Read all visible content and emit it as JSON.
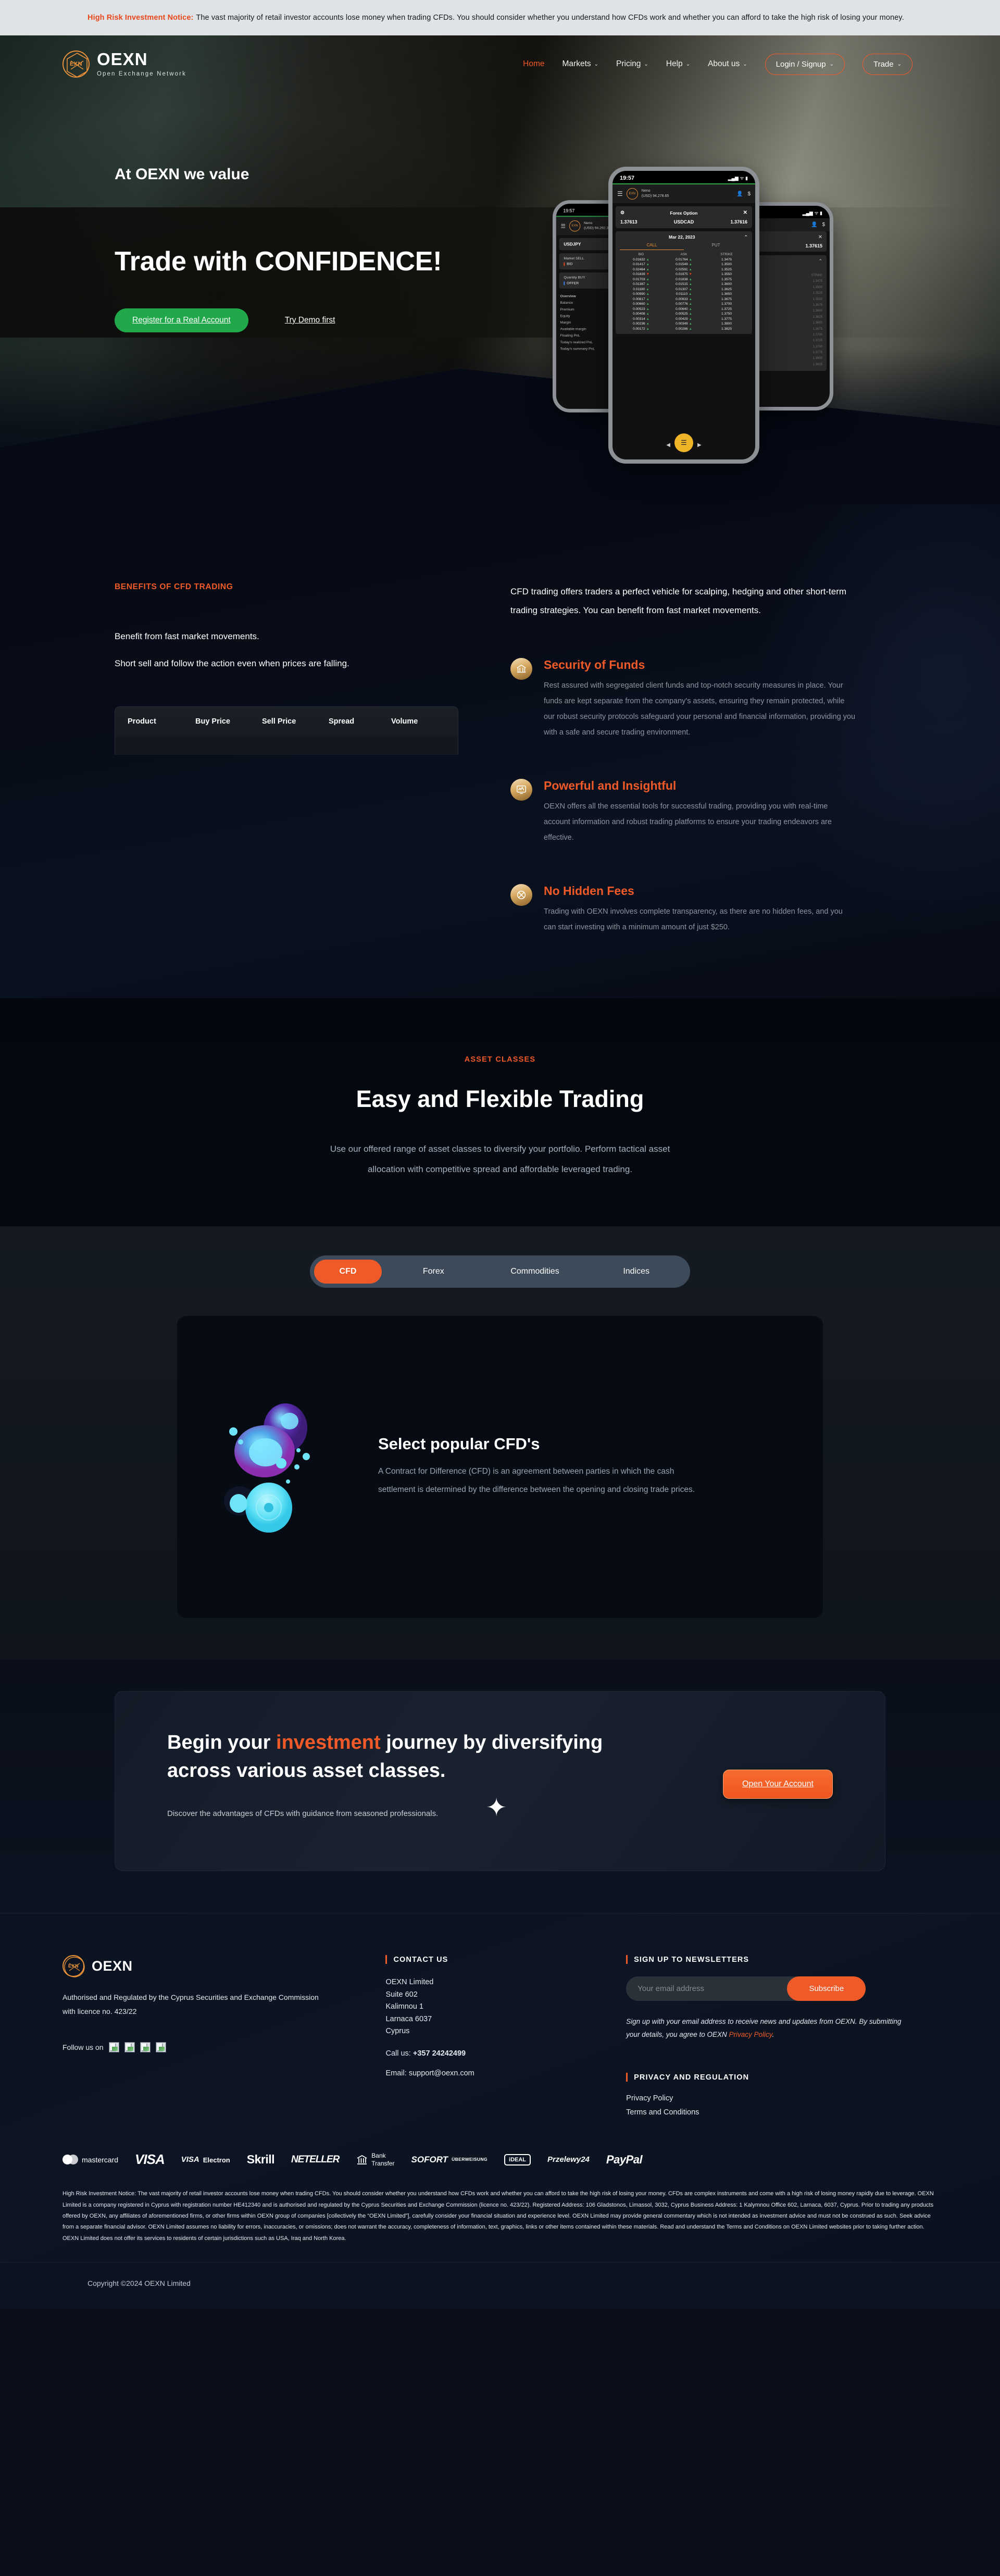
{
  "risk_banner": {
    "bold": "High Risk Investment Notice:",
    "text": " The vast majority of retail investor accounts lose money when trading CFDs. You should consider whether you understand how CFDs work and whether you can afford to take the high risk of losing your money."
  },
  "brand": {
    "name": "OEXN",
    "tagline": "Open Exchange Network",
    "mark": "EXN"
  },
  "nav": {
    "links": [
      {
        "label": "Home",
        "caret": "",
        "active": true
      },
      {
        "label": "Markets",
        "caret": "⌄",
        "active": false
      },
      {
        "label": "Pricing",
        "caret": "⌄",
        "active": false
      },
      {
        "label": "Help",
        "caret": "⌄",
        "active": false
      },
      {
        "label": "About us",
        "caret": "⌄",
        "active": false
      }
    ],
    "login_button": "Login / Signup",
    "login_caret": "⌄",
    "trade_button": "Trade",
    "trade_caret": "⌄"
  },
  "hero": {
    "kicker": "At OEXN we value",
    "title": "Trade with CONFIDENCE!",
    "cta_primary": "Register for a Real Account",
    "cta_secondary": "Try Demo first"
  },
  "phone": {
    "time": "19:57",
    "account_name": "Neno",
    "account_balance": "(USD) 94,278.65",
    "left_time": "19:57",
    "left_account_balance": "(USD) 94,292.39",
    "left_pair": "USDJPY",
    "left_market_sell": "Market SELL",
    "left_bid": "BID",
    "left_quantity_buy": "Quantity BUY",
    "left_offer": "OFFER",
    "left_overview": "Overview",
    "left_rows": [
      "Balance",
      "Premium",
      "Equity",
      "Margin",
      "Available margin",
      "Floating PnL",
      "Today's realized PnL",
      "Today's summary PnL"
    ],
    "card_title": "Forex Option",
    "bid_quote": "1.37613",
    "pair": "USDCAD",
    "ask_quote": "1.37616",
    "right_quote": "1.37615",
    "date": "Mar 22, 2023",
    "tab_call": "CALL",
    "tab_put": "PUT",
    "columns": [
      "BID",
      "ASK",
      "STRIKE"
    ],
    "rows": [
      {
        "bid": "0.01632",
        "bid_dir": "up",
        "ask": "0.01764",
        "ask_dir": "up",
        "strike": "1.3475"
      },
      {
        "bid": "0.01417",
        "bid_dir": "up",
        "ask": "0.01549",
        "ask_dir": "up",
        "strike": "1.3500"
      },
      {
        "bid": "0.02464",
        "bid_dir": "up",
        "ask": "0.02591",
        "ask_dir": "up",
        "strike": "1.3525"
      },
      {
        "bid": "0.01839",
        "bid_dir": "down",
        "ask": "0.01975",
        "ask_dir": "down",
        "strike": "1.3550"
      },
      {
        "bid": "0.01703",
        "bid_dir": "up",
        "ask": "0.01838",
        "ask_dir": "up",
        "strike": "1.3575"
      },
      {
        "bid": "0.01387",
        "bid_dir": "up",
        "ask": "0.01515",
        "ask_dir": "up",
        "strike": "1.3600"
      },
      {
        "bid": "0.01180",
        "bid_dir": "up",
        "ask": "0.01307",
        "ask_dir": "up",
        "strike": "1.3625"
      },
      {
        "bid": "0.00990",
        "bid_dir": "up",
        "ask": "0.01110",
        "ask_dir": "up",
        "strike": "1.3650"
      },
      {
        "bid": "0.00817",
        "bid_dir": "up",
        "ask": "0.00933",
        "ask_dir": "up",
        "strike": "1.3675"
      },
      {
        "bid": "0.00660",
        "bid_dir": "up",
        "ask": "0.00776",
        "ask_dir": "up",
        "strike": "1.3700"
      },
      {
        "bid": "0.00523",
        "bid_dir": "up",
        "ask": "0.00640",
        "ask_dir": "up",
        "strike": "1.3725"
      },
      {
        "bid": "0.00408",
        "bid_dir": "up",
        "ask": "0.00525",
        "ask_dir": "up",
        "strike": "1.3750"
      },
      {
        "bid": "0.00314",
        "bid_dir": "up",
        "ask": "0.00429",
        "ask_dir": "up",
        "strike": "1.3775"
      },
      {
        "bid": "0.00236",
        "bid_dir": "up",
        "ask": "0.00349",
        "ask_dir": "up",
        "strike": "1.3800"
      },
      {
        "bid": "0.00172",
        "bid_dir": "up",
        "ask": "0.00286",
        "ask_dir": "up",
        "strike": "1.3825"
      }
    ]
  },
  "benefits": {
    "kicker": "BENEFITS OF CFD TRADING",
    "line1": "Benefit from fast market movements.",
    "line2": "Short sell and follow the action even when prices are falling.",
    "intro": "CFD trading offers traders a perfect vehicle for scalping, hedging and other short-term trading strategies. You can benefit from fast market movements.",
    "table_headers": [
      "Product",
      "Buy Price",
      "Sell Price",
      "Spread",
      "Volume"
    ],
    "features": [
      {
        "icon": "bank-icon",
        "glyph": "ἽB",
        "title": "Security of Funds",
        "body": "Rest assured with segregated client funds and top-notch security measures in place. Your funds are kept separate from the company's assets, ensuring they remain protected, while our robust security protocols safeguard your personal and financial information, providing you with a safe and secure trading environment."
      },
      {
        "icon": "monitor-chart-icon",
        "glyph": "Ὄ8",
        "title": "Powerful and Insightful",
        "body": "OEXN offers all the essential tools for successful trading, providing you with real-time account information and robust trading platforms to ensure your trading endeavors are effective."
      },
      {
        "icon": "no-fees-icon",
        "glyph": "⊗",
        "title": "No Hidden Fees",
        "body": "Trading with OEXN involves complete transparency, as there are no hidden fees, and you can start investing with a minimum amount of just $250."
      }
    ]
  },
  "assets": {
    "kicker": "ASSET CLASSES",
    "title": "Easy and Flexible Trading",
    "subtitle": "Use our offered range of asset classes to diversify your portfolio. Perform tactical asset allocation with competitive spread and affordable leveraged trading.",
    "tabs": [
      {
        "label": "CFD",
        "active": true
      },
      {
        "label": "Forex",
        "active": false
      },
      {
        "label": "Commodities",
        "active": false
      },
      {
        "label": "Indices",
        "active": false
      }
    ],
    "panel": {
      "title": "Select popular CFD's",
      "body": "A Contract for Difference (CFD) is an agreement between parties in which the cash settlement is determined by the difference between the opening and closing trade prices."
    }
  },
  "cta": {
    "title_1": "Begin your ",
    "title_accent": "investment",
    "title_2": " journey by diversifying across various asset classes.",
    "subtitle": "Discover the advantages of CFDs with guidance from seasoned professionals.",
    "button": "Open Your Account",
    "sparkle": "✦"
  },
  "footer": {
    "brand_name": "OEXN",
    "regulation": "Authorised and Regulated by the Cyprus Securities and Exchange Commission with licence no. 423/22",
    "follow_label": "Follow us on",
    "social_icons": [
      "facebook-icon",
      "twitter-icon",
      "linkedin-icon",
      "instagram-icon"
    ],
    "contact": {
      "heading": "CONTACT US",
      "address": [
        "OEXN Limited",
        "Suite 602",
        "Kalimnou 1",
        "Larnaca 6037",
        "Cyprus"
      ],
      "call_label": "Call us: ",
      "phone": "+357 24242499",
      "email_label": "Email: ",
      "email": "support@oexn.com"
    },
    "newsletter": {
      "heading": "SIGN UP TO NEWSLETTERS",
      "placeholder": "Your email address",
      "button": "Subscribe",
      "note": "Sign up with your email address to receive news and updates from OEXN. By submitting your details, you agree to OEXN ",
      "note_link": "Privacy Policy",
      "note_end": "."
    },
    "privacy": {
      "heading": "PRIVACY AND REGULATION",
      "links": [
        "Privacy Policy",
        "Terms and Conditions"
      ]
    },
    "payments": [
      "mastercard",
      "VISA",
      "VISA Electron",
      "Skrill",
      "NETELLER",
      "Bank Transfer",
      "SOFORT ÜBERWEISUNG",
      "iDEAL",
      "Przelewy24",
      "PayPal"
    ],
    "legal": "High Risk Investment Notice: The vast majority of retail investor accounts lose money when trading CFDs. You should consider whether you understand how CFDs work and whether you can afford to take the high risk of losing your money. CFDs are complex instruments and come with a high risk of losing money rapidly due to leverage. OEXN Limited is a company registered in Cyprus with registration number HE412340 and is authorised and regulated by the Cyprus Securities and Exchange Commission (licence no. 423/22). Registered Address: 106 Gladstonos, Limassol, 3032, Cyprus Business Address: 1 Kalymnou Office 602, Larnaca, 6037, Cyprus. Prior to trading any products offered by OEXN, any affiliates of aforementioned firms, or other firms within OEXN group of companies [collectively the “OEXN Limited”], carefully consider your financial situation and experience level. OEXN Limited may provide general commentary which is not intended as investment advice and must not be construed as such. Seek advice from a separate financial advisor. OEXN Limited assumes no liability for errors, inaccuracies, or omissions; does not warrant the accuracy, completeness of information, text, graphics, links or other items contained within these materials. Read and understand the Terms and Conditions on OEXN Limited websites prior to taking further action. OEXN Limited does not offer its services to residents of certain jurisdictions such as USA, Iraq and North Korea.",
    "copyright": "Copyright ©2024 OEXN Limited"
  },
  "colors": {
    "accent": "#f05a28",
    "accent_red": "#e8481c",
    "green": "#21a84a",
    "gold": "#e8913a",
    "dark_bg": "#050a16"
  }
}
